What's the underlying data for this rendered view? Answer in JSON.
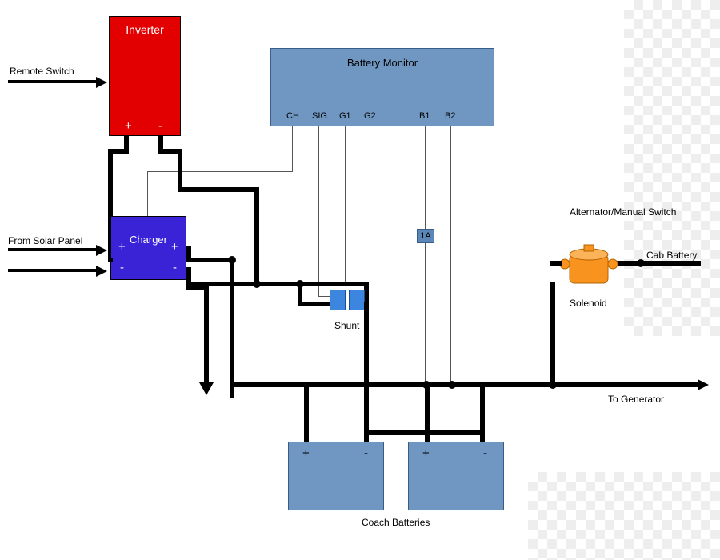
{
  "components": {
    "inverter": {
      "label": "Inverter",
      "plus": "+",
      "minus": "-"
    },
    "battery_monitor": {
      "label": "Battery Monitor",
      "terminals": [
        "CH",
        "SIG",
        "G1",
        "G2",
        "B1",
        "B2"
      ]
    },
    "charger": {
      "label": "Charger",
      "plus_l": "+",
      "plus_r": "+",
      "minus_l": "-",
      "minus_r": "-"
    },
    "one_amp": "1A",
    "shunt": "Shunt",
    "coach_batteries": "Coach Batteries",
    "solenoid": "Solenoid"
  },
  "labels": {
    "remote_switch": "Remote Switch",
    "from_solar_panel": "From Solar Panel",
    "to_generator": "To Generator",
    "alt_manual_switch": "Alternator/Manual Switch",
    "cab_battery": "Cab Battery"
  },
  "battery_terminals": {
    "plus": "+",
    "minus": "-"
  }
}
